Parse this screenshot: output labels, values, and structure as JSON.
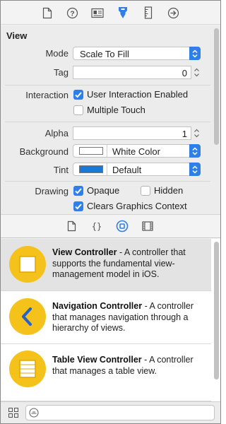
{
  "toolbar": {
    "icons": [
      "file-inspector-icon",
      "quick-help-icon",
      "identity-inspector-icon",
      "attributes-inspector-icon",
      "size-inspector-icon",
      "connections-inspector-icon"
    ],
    "active_index": 3,
    "accent": "#2f7fe8"
  },
  "view_section": {
    "title": "View",
    "mode": {
      "label": "Mode",
      "value": "Scale To Fill"
    },
    "tag": {
      "label": "Tag",
      "value": "0"
    },
    "interaction": {
      "label": "Interaction",
      "options": [
        {
          "label": "User Interaction Enabled",
          "checked": true
        },
        {
          "label": "Multiple Touch",
          "checked": false
        }
      ]
    },
    "alpha": {
      "label": "Alpha",
      "value": "1"
    },
    "background": {
      "label": "Background",
      "value": "White Color",
      "swatch": "#ffffff"
    },
    "tint": {
      "label": "Tint",
      "value": "Default",
      "swatch": "#1a78d6"
    },
    "drawing": {
      "label": "Drawing",
      "opaque": {
        "label": "Opaque",
        "checked": true
      },
      "hidden": {
        "label": "Hidden",
        "checked": false
      },
      "clears": {
        "label": "Clears Graphics Context",
        "checked": true
      }
    }
  },
  "library_tabs": {
    "icons": [
      "file-template-icon",
      "code-snippet-icon",
      "object-library-icon",
      "media-library-icon"
    ],
    "active_index": 2
  },
  "library_items": [
    {
      "title": "View Controller",
      "description": " - A controller that supports the fundamental view-management model in iOS.",
      "icon": "view-controller-icon",
      "selected": true
    },
    {
      "title": "Navigation Controller",
      "description": " - A controller that manages navigation through a hierarchy of views.",
      "icon": "navigation-controller-icon",
      "selected": false
    },
    {
      "title": "Table View Controller",
      "description": " - A controller that manages a table view.",
      "icon": "table-view-controller-icon",
      "selected": false
    }
  ],
  "bottom_bar": {
    "grid_icon": "grid-view-icon",
    "filter_icon": "filter-icon",
    "filter_value": ""
  }
}
